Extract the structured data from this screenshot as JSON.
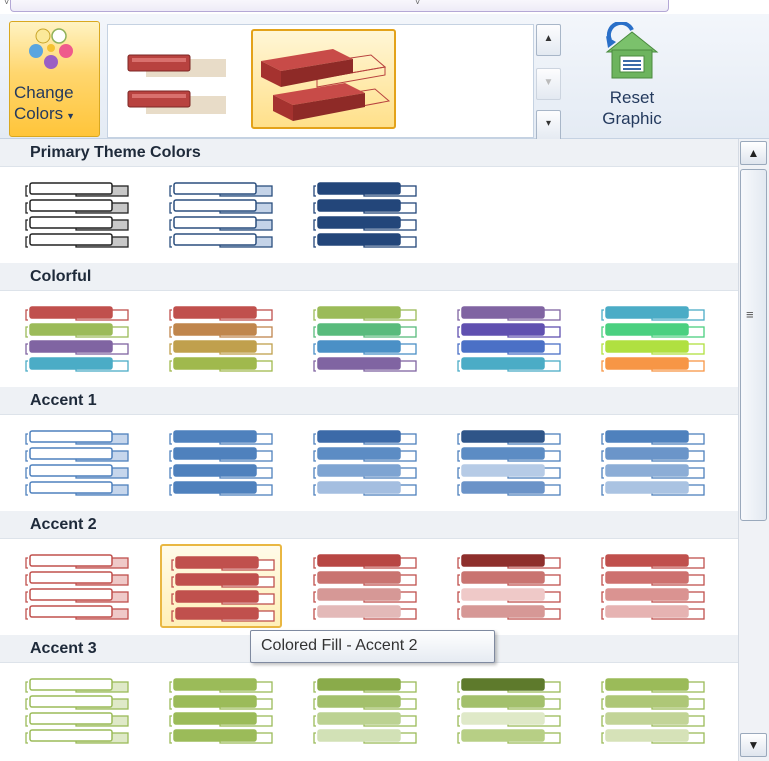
{
  "ribbon": {
    "change_colors_line1": "Change",
    "change_colors_line2": "Colors",
    "reset_line1": "Reset",
    "reset_line2": "Graphic"
  },
  "scrollbar": {
    "up": "▲",
    "down": "▼",
    "grip": "≡"
  },
  "tooltip": "Colored Fill - Accent 2",
  "sections": [
    {
      "title": "Primary Theme Colors",
      "variants": [
        {
          "type": "outline",
          "stroke": [
            "#222222",
            "#222222",
            "#222222",
            "#222222"
          ],
          "fill": [
            "#ffffff",
            "#ffffff",
            "#ffffff",
            "#ffffff"
          ],
          "tab": [
            "#c8c8c8",
            "#c8c8c8",
            "#c8c8c8",
            "#c8c8c8"
          ]
        },
        {
          "type": "outline",
          "stroke": [
            "#2b4f7e",
            "#2b4f7e",
            "#2b4f7e",
            "#2b4f7e"
          ],
          "fill": [
            "#ffffff",
            "#ffffff",
            "#ffffff",
            "#ffffff"
          ],
          "tab": [
            "#c4d3e8",
            "#c4d3e8",
            "#c4d3e8",
            "#c4d3e8"
          ]
        },
        {
          "type": "filled",
          "color": [
            "#23467a",
            "#23467a",
            "#23467a",
            "#23467a"
          ],
          "stroke": "#23467a"
        }
      ]
    },
    {
      "title": "Colorful",
      "variants": [
        {
          "type": "filled",
          "color": [
            "#c0504d",
            "#9bbb59",
            "#8064a2",
            "#4bacc6"
          ],
          "stroke": [
            "#c0504d",
            "#9bbb59",
            "#8064a2",
            "#4bacc6"
          ]
        },
        {
          "type": "filled",
          "color": [
            "#c0504d",
            "#c0864d",
            "#c0a04d",
            "#a0b94d"
          ],
          "stroke": [
            "#c0504d",
            "#c0864d",
            "#c0a04d",
            "#a0b94d"
          ]
        },
        {
          "type": "filled",
          "color": [
            "#9bbb59",
            "#59bb7c",
            "#4b90c6",
            "#8064a2"
          ],
          "stroke": [
            "#9bbb59",
            "#59bb7c",
            "#4b90c6",
            "#8064a2"
          ]
        },
        {
          "type": "filled",
          "color": [
            "#8064a2",
            "#6050b0",
            "#4b70c6",
            "#4bacc6"
          ],
          "stroke": [
            "#8064a2",
            "#6050b0",
            "#4b70c6",
            "#4bacc6"
          ]
        },
        {
          "type": "filled",
          "color": [
            "#4bacc6",
            "#4bd080",
            "#b0e040",
            "#f79646"
          ],
          "stroke": [
            "#4bacc6",
            "#4bd080",
            "#b0e040",
            "#f79646"
          ]
        }
      ]
    },
    {
      "title": "Accent 1",
      "variants": [
        {
          "type": "outline",
          "stroke": [
            "#4f81bd",
            "#4f81bd",
            "#4f81bd",
            "#4f81bd"
          ],
          "fill": [
            "#ffffff",
            "#ffffff",
            "#ffffff",
            "#ffffff"
          ],
          "tab": [
            "#c6d6ec",
            "#c6d6ec",
            "#c6d6ec",
            "#c6d6ec"
          ]
        },
        {
          "type": "filled",
          "color": [
            "#4f81bd",
            "#4f81bd",
            "#4f81bd",
            "#4f81bd"
          ],
          "stroke": "#4f81bd"
        },
        {
          "type": "filled",
          "color": [
            "#3c6aa8",
            "#5c8cc4",
            "#7ea4d2",
            "#a4bee0"
          ],
          "stroke": "#4f81bd"
        },
        {
          "type": "filled",
          "color": [
            "#2f5588",
            "#5c8cc4",
            "#b6cbe6",
            "#6b93c8"
          ],
          "stroke": "#4f81bd"
        },
        {
          "type": "filled",
          "color": [
            "#4f81bd",
            "#6b95c9",
            "#8cadd6",
            "#aac3e2"
          ],
          "stroke": "#4f81bd"
        }
      ]
    },
    {
      "title": "Accent 2",
      "variants": [
        {
          "type": "outline",
          "stroke": [
            "#c0504d",
            "#c0504d",
            "#c0504d",
            "#c0504d"
          ],
          "fill": [
            "#ffffff",
            "#ffffff",
            "#ffffff",
            "#ffffff"
          ],
          "tab": [
            "#efc9c8",
            "#efc9c8",
            "#efc9c8",
            "#efc9c8"
          ]
        },
        {
          "type": "filled",
          "color": [
            "#c0504d",
            "#c0504d",
            "#c0504d",
            "#c0504d"
          ],
          "stroke": "#c0504d"
        },
        {
          "type": "filled",
          "color": [
            "#b84744",
            "#c97471",
            "#d69896",
            "#e3b9b8"
          ],
          "stroke": "#c0504d"
        },
        {
          "type": "filled",
          "color": [
            "#8e2f2c",
            "#c97471",
            "#efc9c8",
            "#d69896"
          ],
          "stroke": "#c0504d"
        },
        {
          "type": "filled",
          "color": [
            "#c0504d",
            "#cd716f",
            "#da9391",
            "#e6b3b2"
          ],
          "stroke": "#c0504d"
        }
      ]
    },
    {
      "title": "Accent 3",
      "variants": [
        {
          "type": "outline",
          "stroke": [
            "#9bbb59",
            "#9bbb59",
            "#9bbb59",
            "#9bbb59"
          ],
          "fill": [
            "#ffffff",
            "#ffffff",
            "#ffffff",
            "#ffffff"
          ],
          "tab": [
            "#dfe9c8",
            "#dfe9c8",
            "#dfe9c8",
            "#dfe9c8"
          ]
        },
        {
          "type": "filled",
          "color": [
            "#9bbb59",
            "#9bbb59",
            "#9bbb59",
            "#9bbb59"
          ],
          "stroke": "#9bbb59"
        },
        {
          "type": "filled",
          "color": [
            "#8aab4a",
            "#a3c06c",
            "#bcd292",
            "#d2e1b6"
          ],
          "stroke": "#9bbb59"
        },
        {
          "type": "filled",
          "color": [
            "#5e7a2c",
            "#a3c06c",
            "#dfe9c8",
            "#b7cf85"
          ],
          "stroke": "#9bbb59"
        },
        {
          "type": "filled",
          "color": [
            "#9bbb59",
            "#aec777",
            "#c2d497",
            "#d6e2b8"
          ],
          "stroke": "#9bbb59"
        }
      ]
    }
  ],
  "hovered": {
    "section": 3,
    "variant": 1
  }
}
